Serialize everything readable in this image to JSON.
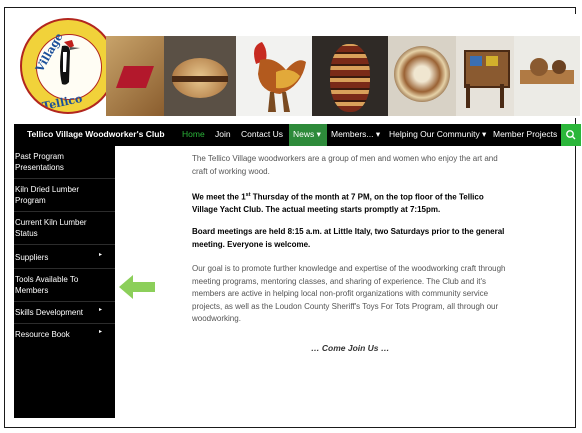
{
  "site_title": "Tellico Village Woodworker's Club",
  "logo": {
    "top_text": "Village Woodworkers",
    "bottom_text": "Tellico"
  },
  "nav": {
    "items": [
      {
        "label": "Home"
      },
      {
        "label": "Join"
      },
      {
        "label": "Contact Us"
      },
      {
        "label": "News ▾"
      },
      {
        "label": "Members... ▾"
      },
      {
        "label": "Helping Our Community ▾"
      },
      {
        "label": "Member Projects"
      }
    ],
    "search_icon": "search-icon",
    "active_color": "#2bb63a"
  },
  "sidebar": {
    "items": [
      {
        "label": "Past Program Presentations"
      },
      {
        "label": "Kiln Dried Lumber Program"
      },
      {
        "label": "Current Kiln Lumber Status"
      },
      {
        "label": "Suppliers"
      },
      {
        "label": "Tools Available To Members"
      },
      {
        "label": "Skills Development"
      },
      {
        "label": "Resource Book"
      }
    ]
  },
  "content": {
    "intro": "The Tellico Village woodworkers are a group of men and women who enjoy the art and craft of working wood.",
    "meeting_a": "We meet the 1",
    "meeting_sup": "st",
    "meeting_b": " Thursday of the month at 7 PM, on the top floor of the Tellico Village Yacht Club.  The actual meeting starts promptly at 7:15pm.",
    "board": "Board meetings are held 8:15 a.m. at Little Italy, two Saturdays prior to the general meeting.  Everyone is welcome.",
    "goal": "Our goal is to promote further knowledge and expertise of the woodworking craft through meeting programs, mentoring classes, and sharing of experience. The Club and it's members are active in helping local non-profit organizations with community service projects, as well as the Loudon County Sheriff's Toys For Tots Program, all through our woodworking.",
    "join": "… Come Join Us …"
  },
  "colors": {
    "accent_green": "#2bb63a",
    "nav_bg": "#000000",
    "pointer_arrow": "#8ccf5a"
  }
}
